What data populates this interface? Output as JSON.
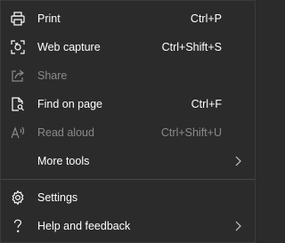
{
  "menu": {
    "items": [
      {
        "label": "Print",
        "shortcut": "Ctrl+P",
        "icon": "printer-icon",
        "disabled": false
      },
      {
        "label": "Web capture",
        "shortcut": "Ctrl+Shift+S",
        "icon": "web-capture-icon",
        "disabled": false
      },
      {
        "label": "Share",
        "shortcut": "",
        "icon": "share-icon",
        "disabled": true
      },
      {
        "label": "Find on page",
        "shortcut": "Ctrl+F",
        "icon": "find-on-page-icon",
        "disabled": false
      },
      {
        "label": "Read aloud",
        "shortcut": "Ctrl+Shift+U",
        "icon": "read-aloud-icon",
        "disabled": true
      },
      {
        "label": "More tools",
        "shortcut": "",
        "icon": "",
        "submenu": true,
        "disabled": false
      },
      {
        "label": "Settings",
        "shortcut": "",
        "icon": "gear-icon",
        "disabled": false
      },
      {
        "label": "Help and feedback",
        "shortcut": "",
        "icon": "help-icon",
        "submenu": true,
        "disabled": false
      }
    ]
  },
  "colors": {
    "background": "#2b2b2b",
    "text": "#ffffff",
    "disabled_text": "#8a8a8a",
    "separator": "#474747"
  }
}
